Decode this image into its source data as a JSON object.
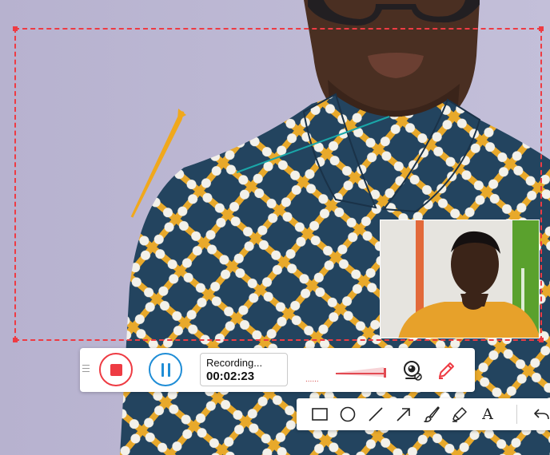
{
  "recording": {
    "status_label": "Recording...",
    "elapsed_time": "00:02:23",
    "audio_indicator": "......"
  },
  "colors": {
    "region_border": "#ee3b43",
    "stop": "#ee3b43",
    "pause": "#1f8dd6",
    "pen_active": "#ee3b43"
  },
  "icons": {
    "stop_button": "stop-icon",
    "pause_button": "pause-icon",
    "webcam_toggle": "webcam-icon",
    "annotate": "pencil-icon",
    "drag_grip": "drag-grip-icon"
  },
  "annotation_tools": [
    {
      "name": "rectangle",
      "icon": "rectangle-icon"
    },
    {
      "name": "ellipse",
      "icon": "ellipse-icon"
    },
    {
      "name": "line",
      "icon": "line-icon"
    },
    {
      "name": "arrow",
      "icon": "arrow-icon"
    },
    {
      "name": "brush",
      "icon": "brush-icon"
    },
    {
      "name": "highlighter",
      "icon": "highlighter-icon"
    },
    {
      "name": "text",
      "icon": "text-icon",
      "glyph": "A"
    },
    {
      "name": "undo",
      "icon": "undo-icon"
    }
  ]
}
